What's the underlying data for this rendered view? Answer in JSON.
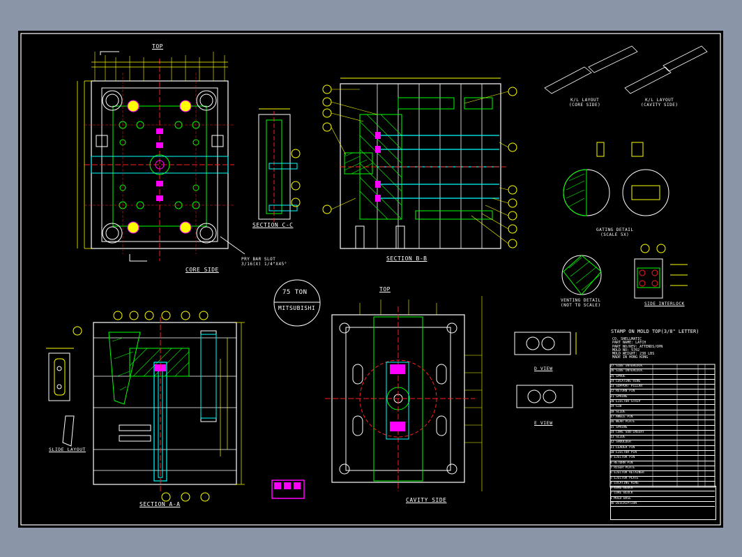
{
  "views": {
    "top_label": "TOP",
    "core_side": "CORE SIDE",
    "section_cc": "SECTION C-C",
    "section_bb": "SECTION B-B",
    "section_aa": "SECTION A-A",
    "cavity_top": "TOP",
    "cavity_side": "CAVITY SIDE",
    "slide_layout": "SLIDE LAYOUT",
    "d_view": "D VIEW",
    "e_view": "E VIEW",
    "kl_layout_core": "K/L LAYOUT\n(CORE SIDE)",
    "kl_layout_cavity": "K/L LAYOUT\n(CAVITY SIDE)",
    "gating_detail": "GATING DETAIL\n(SCALE 5X)",
    "venting_detail": "VENTING DETAIL\n(NOT TO SCALE)",
    "side_interlock": "SIDE INTERLOCK",
    "pry_bar_slot": "PRY BAR SLOT\n3/16(X) 1/4\"X45°"
  },
  "press": {
    "tonnage": "75 TON",
    "maker": "MITSUBISHI"
  },
  "stamp_title": "STAMP ON MOLD TOP(3/8\" LETTER)",
  "stamp_notes": [
    "CO. SHELLMATIC",
    "PART NAME: LATCH",
    "PART NO/REV: ATTENDS/OPN",
    "MOLD NO: 5702",
    "MOLD WEIGHT: 238 LBS",
    "MADE IN HONG KONG"
  ],
  "bom_rows": [
    "27 SIDE INTERLOCK",
    "26 SIDE INTERLOCK",
    "25 SPRUE",
    "24 LOCATING RING",
    "23 SUPPORT PILLAR",
    "22 RETURN PIN",
    "21 SPRING",
    "20 EJECTOR STRIP",
    "19 GIB",
    "18 SLIDE",
    "17 ANGLE PIN",
    "16 WEAR PLATE",
    "15 SPRING",
    "14 CORE SUB-INSERT",
    "13 SLIDE",
    "12 SHOULDER",
    "11 LEADER PIN",
    "10 EJECTOR PIN",
    "9 EJECTOR PIN",
    "8 RETURN PIN",
    "7 RISER PLATE",
    "6 EJECTOR RETAINER",
    "5 EJECTOR PLATE",
    "4 LOCATING RING",
    "3 CORE BLOCK",
    "2 CORE BLOCK",
    "1 MOLD BASE",
    "NO DESCRIPTION"
  ],
  "colors": {
    "sheet": "#000000",
    "frame": "#ffffff",
    "outline": "#ffffff",
    "centerline": "#ff2020",
    "dimension": "#ffff00",
    "hidden": "#00ff00",
    "hatch": "#00ff00",
    "part": "#00ffff",
    "callout": "#ffff00",
    "highlight": "#ff00ff"
  }
}
